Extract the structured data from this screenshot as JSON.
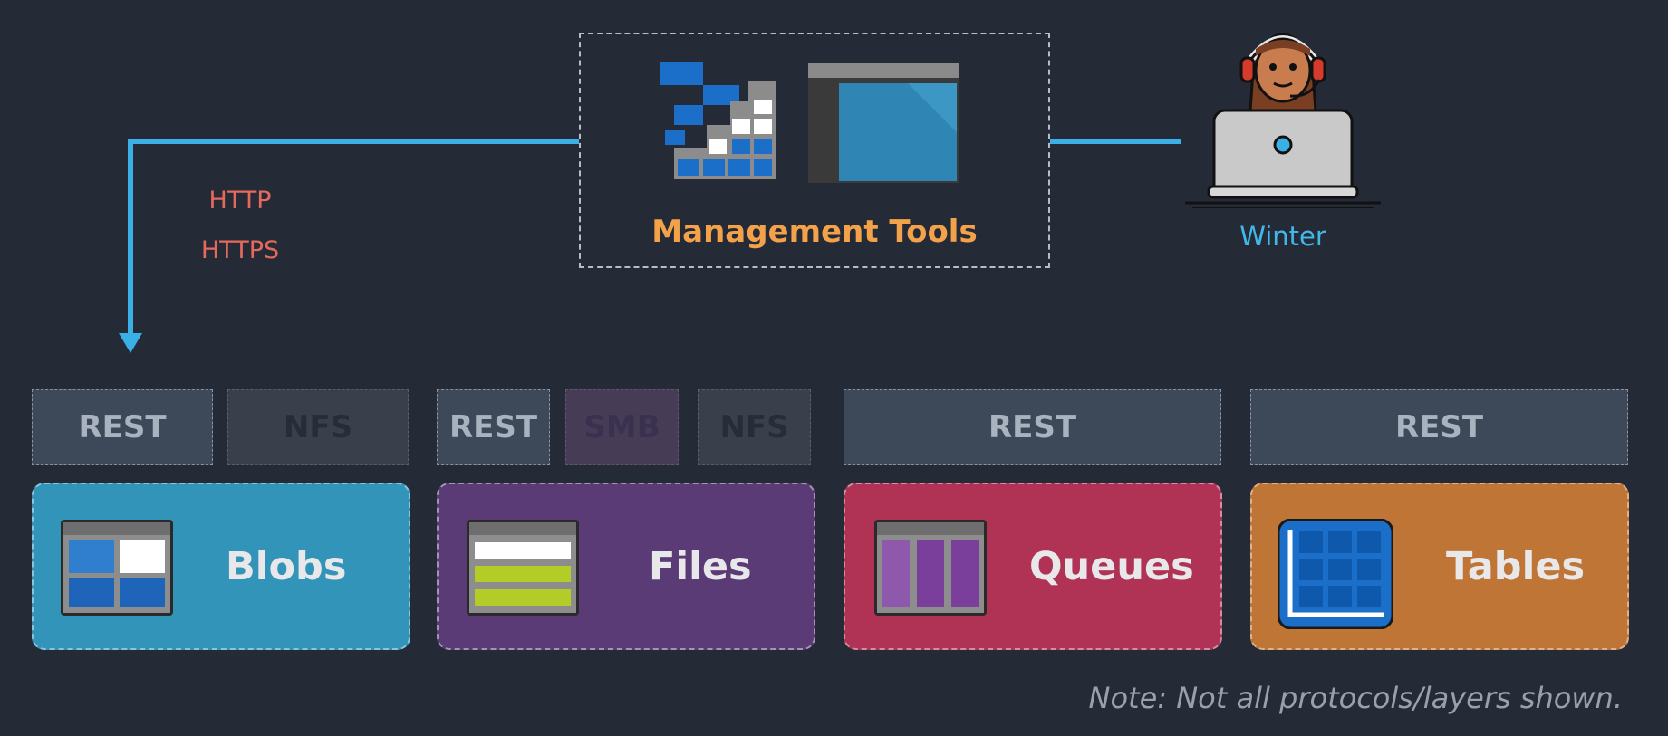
{
  "management": {
    "label": "Management Tools"
  },
  "user": {
    "name": "Winter"
  },
  "connection": {
    "protocols": [
      "HTTP",
      "HTTPS"
    ]
  },
  "protocol_boxes": [
    {
      "label": "REST",
      "kind": "rest"
    },
    {
      "label": "NFS",
      "kind": "nfs"
    },
    {
      "label": "REST",
      "kind": "rest"
    },
    {
      "label": "SMB",
      "kind": "smb"
    },
    {
      "label": "NFS",
      "kind": "nfs"
    },
    {
      "label": "REST",
      "kind": "rest"
    },
    {
      "label": "REST",
      "kind": "rest"
    }
  ],
  "services": [
    {
      "label": "Blobs",
      "color": "#3294b8",
      "icon": "blob-storage-icon"
    },
    {
      "label": "Files",
      "color": "#5b3b76",
      "icon": "file-storage-icon"
    },
    {
      "label": "Queues",
      "color": "#b03356",
      "icon": "queue-storage-icon"
    },
    {
      "label": "Tables",
      "color": "#be7535",
      "icon": "table-storage-icon"
    }
  ],
  "colors": {
    "background": "#252a37",
    "connector": "#3ab0e6",
    "management_label": "#f3a24a",
    "protocol_text": "#e56a5b",
    "user_label": "#42b7ea"
  },
  "note": "Note: Not all protocols/layers shown."
}
